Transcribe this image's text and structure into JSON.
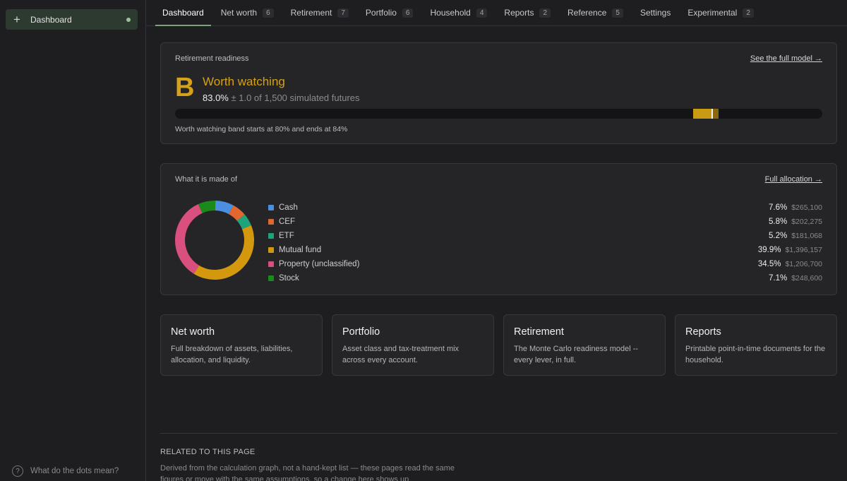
{
  "sidebar": {
    "item": {
      "label": "Dashboard",
      "icon": "plus-icon"
    },
    "help": {
      "label": "What do the dots mean?",
      "icon_glyph": "?"
    }
  },
  "nav": {
    "tabs": [
      {
        "label": "Dashboard",
        "count": ""
      },
      {
        "label": "Net worth",
        "count": "6"
      },
      {
        "label": "Retirement",
        "count": "7"
      },
      {
        "label": "Portfolio",
        "count": "6"
      },
      {
        "label": "Household",
        "count": "4"
      },
      {
        "label": "Reports",
        "count": "2"
      },
      {
        "label": "Reference",
        "count": "5"
      },
      {
        "label": "Settings",
        "count": ""
      },
      {
        "label": "Experimental",
        "count": "2"
      }
    ]
  },
  "readiness": {
    "heading": "Retirement readiness",
    "link": "See the full model →",
    "grade": "B",
    "status": "Worth watching",
    "pct": "83.0%",
    "range": " ± 1.0 of 1,500 simulated futures",
    "band_start_pct": 80,
    "band_end_pct": 84,
    "value_pct": 83.0,
    "band_note": "Worth watching band starts at 80% and ends at 84%",
    "accent_color": "#d4a119"
  },
  "allocation": {
    "heading": "What it is made of",
    "link": "Full allocation →",
    "items": [
      {
        "label": "Cash",
        "pct": "7.6%",
        "amount": "$265,100",
        "value": 7.6,
        "color": "#4a8fe0"
      },
      {
        "label": "CEF",
        "pct": "5.8%",
        "amount": "$202,275",
        "value": 5.8,
        "color": "#e0672e"
      },
      {
        "label": "ETF",
        "pct": "5.2%",
        "amount": "$181,068",
        "value": 5.2,
        "color": "#1fa37a"
      },
      {
        "label": "Mutual fund",
        "pct": "39.9%",
        "amount": "$1,396,157",
        "value": 39.9,
        "color": "#d4980f"
      },
      {
        "label": "Property (unclassified)",
        "pct": "34.5%",
        "amount": "$1,206,700",
        "value": 34.5,
        "color": "#d9507e"
      },
      {
        "label": "Stock",
        "pct": "7.1%",
        "amount": "$248,600",
        "value": 7.1,
        "color": "#1a8a1a"
      }
    ]
  },
  "link_cards": [
    {
      "title": "Net worth",
      "desc": "Full breakdown of assets, liabilities, allocation, and liquidity."
    },
    {
      "title": "Portfolio",
      "desc": "Asset class and tax-treatment mix across every account."
    },
    {
      "title": "Retirement",
      "desc": "The Monte Carlo readiness model -- every lever, in full."
    },
    {
      "title": "Reports",
      "desc": "Printable point-in-time documents for the household."
    }
  ],
  "related": {
    "title": "RELATED TO THIS PAGE",
    "desc": "Derived from the calculation graph, not a hand-kept list — these pages read the same figures or move with the same assumptions, so a change here shows up"
  }
}
